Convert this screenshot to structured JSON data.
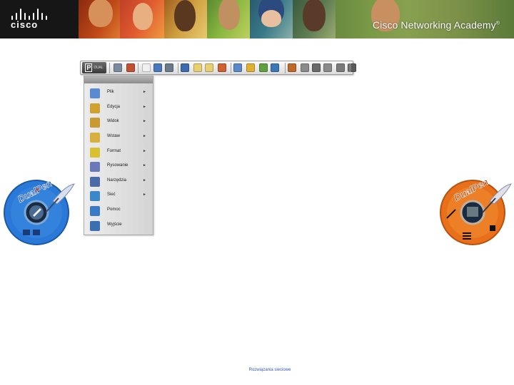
{
  "banner": {
    "logo_text": "cisco",
    "title": "Cisco Networking Academy",
    "trademark": "®"
  },
  "toolbar": {
    "start_label": "P",
    "start_sublabel": "DUAL",
    "icons": [
      {
        "name": "undo-icon",
        "color": "#7a8aa0"
      },
      {
        "name": "redo-icon",
        "color": "#c05030"
      },
      {
        "name": "new-page-icon",
        "color": "#f0f0f0"
      },
      {
        "name": "open-icon",
        "color": "#4a78c0"
      },
      {
        "name": "save-icon",
        "color": "#6a7a8a"
      },
      {
        "name": "cut-icon",
        "color": "#3a6ab0"
      },
      {
        "name": "back-arrow-icon",
        "color": "#e8d070"
      },
      {
        "name": "forward-arrow-icon",
        "color": "#e8d070"
      },
      {
        "name": "page-icon",
        "color": "#d06030"
      },
      {
        "name": "tools-icon",
        "color": "#5a88c8"
      },
      {
        "name": "book-icon",
        "color": "#e0b030"
      },
      {
        "name": "pencil-icon",
        "color": "#60a040"
      },
      {
        "name": "picture-icon",
        "color": "#3a78b8"
      },
      {
        "name": "camera-icon",
        "color": "#c06828"
      },
      {
        "name": "clock-icon",
        "color": "#8a8a8a"
      },
      {
        "name": "zoom-icon",
        "color": "#6a6a6a"
      },
      {
        "name": "hand-icon",
        "color": "#8a8a8a"
      },
      {
        "name": "eraser-icon",
        "color": "#7a7a7a"
      },
      {
        "name": "screen-icon",
        "color": "#5a5a5a"
      }
    ]
  },
  "menu": {
    "items": [
      {
        "label": "Plik",
        "icon": "folder-icon",
        "color": "#5a8ad0",
        "arrow": "►"
      },
      {
        "label": "Edycja",
        "icon": "edit-icon",
        "color": "#d0a030",
        "arrow": "►"
      },
      {
        "label": "Widok",
        "icon": "view-icon",
        "color": "#c89a30",
        "arrow": "►"
      },
      {
        "label": "Wstaw",
        "icon": "insert-icon",
        "color": "#d8b040",
        "arrow": "►"
      },
      {
        "label": "Format",
        "icon": "format-icon",
        "color": "#d8c030",
        "arrow": "►"
      },
      {
        "label": "Rysowanie",
        "icon": "drawing-icon",
        "color": "#6a7ab8",
        "arrow": "►"
      },
      {
        "label": "Narzędzia",
        "icon": "tools-icon",
        "color": "#4a6aa8",
        "arrow": "►"
      },
      {
        "label": "Sieć",
        "icon": "network-icon",
        "color": "#3a88c8",
        "arrow": "►"
      },
      {
        "label": "Pomoc",
        "icon": "help-icon",
        "color": "#3a78c8",
        "arrow": ""
      },
      {
        "label": "Wyjście",
        "icon": "exit-icon",
        "color": "#3a70b0",
        "arrow": ""
      }
    ]
  },
  "logos": {
    "left_text": "DualPen",
    "right_text": "DualPen",
    "left_color": "#2a78d8",
    "right_color": "#e8701a"
  },
  "footer": {
    "link_text": "Rozwiązania sieciowe"
  }
}
